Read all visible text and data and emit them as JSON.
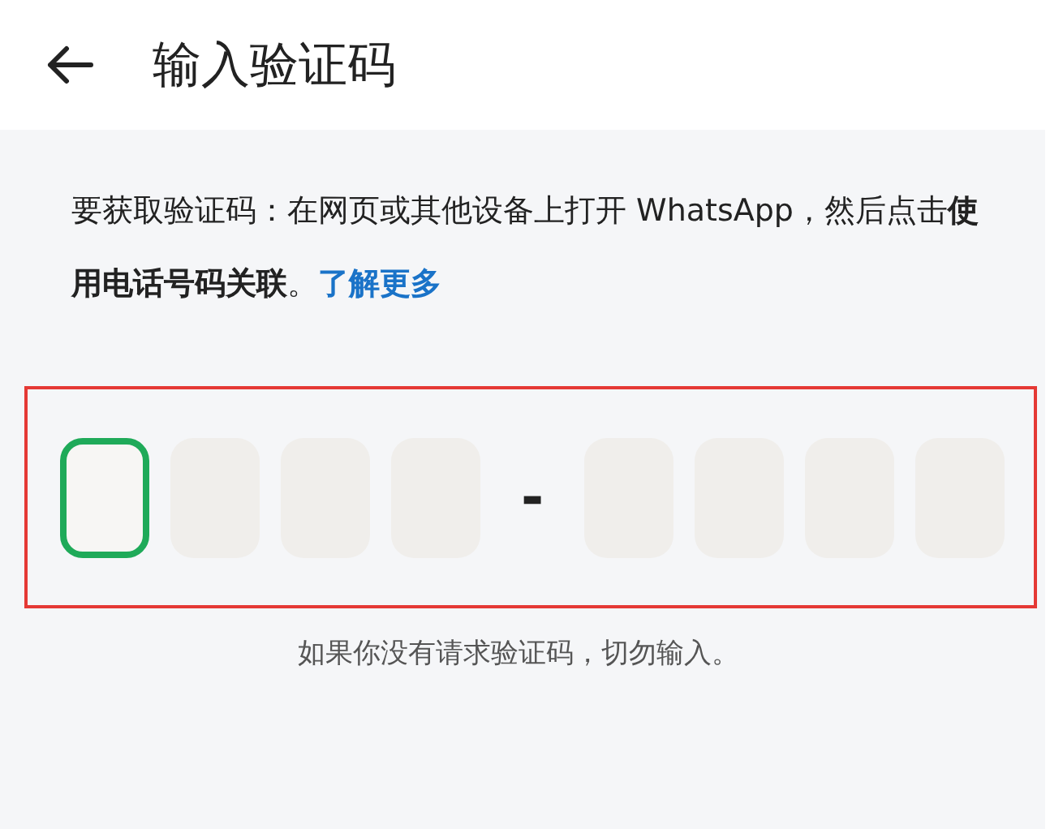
{
  "header": {
    "title": "输入验证码"
  },
  "instructions": {
    "text": "要获取验证码：在网页或其他设备上打开 WhatsApp，然后点击**使用电话号码关联**。",
    "link": "了解更多"
  },
  "code_input": {
    "separator": "-",
    "groups": [
      [
        {
          "focused": true
        },
        {
          "focused": false
        },
        {
          "focused": false
        },
        {
          "focused": false
        }
      ],
      [
        {
          "focused": false
        },
        {
          "focused": false
        },
        {
          "focused": false
        },
        {
          "focused": false
        }
      ]
    ]
  },
  "note": "如果你没有请求验证码，切勿输入。"
}
